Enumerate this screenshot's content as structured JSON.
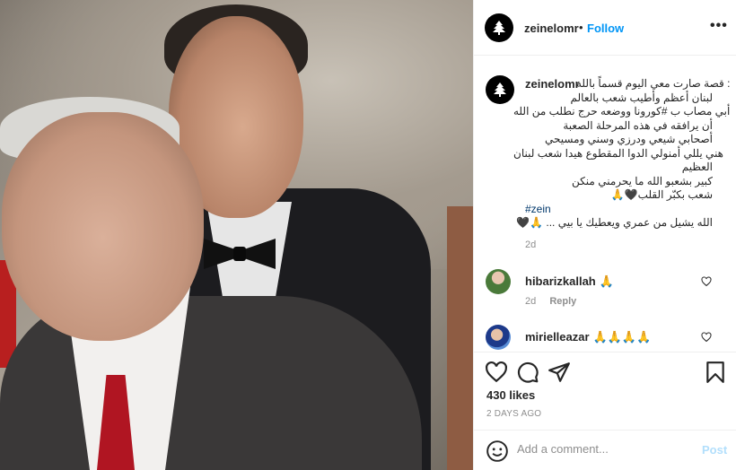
{
  "post": {
    "username": "zeinelomr",
    "dot": "•",
    "follow_label": "Follow",
    "more_label": "•••"
  },
  "caption": {
    "username": "zeinelomr",
    "lines": [
      "قصة صارت معي اليوم قسماً بالله :",
      "لبنان أعظم وأطيب شعب بالعالم",
      "أبي مصاب ب #كورونا ووضعه حرج نطلب من الله",
      "أن يرافقه في هذه المرحلة الصعبة",
      "أصحابي شيعي ودرزي وسني ومسيحي",
      "هني يللي أمنولي الدوا المقطوع هيدا شعب لبنان",
      "العظيم",
      "كبير بشعبو الله ما يحرمني منكن",
      "🙏🖤شعب بكبّر القلب",
      "#zein",
      "🖤🙏 ... الله يشيل من عمري ويعطيك يا بيي"
    ],
    "time": "2d"
  },
  "comments": [
    {
      "user": "hibarizkallah",
      "text": "🙏",
      "time": "2d",
      "reply_label": "Reply"
    },
    {
      "user": "mirielleazar",
      "text": "🙏🙏🙏🙏",
      "time": "",
      "reply_label": ""
    }
  ],
  "actions": {
    "likes": "430 likes",
    "posted_ago": "2 DAYS AGO",
    "comment_placeholder": "Add a comment...",
    "post_label": "Post"
  },
  "icons": [
    "cedar-logo-icon",
    "heart-icon",
    "comment-icon",
    "share-icon",
    "bookmark-icon",
    "emoji-icon",
    "more-icon"
  ],
  "colors": {
    "link": "#0095f6",
    "post_disabled": "#b2dffc",
    "meta": "#8e8e8e",
    "tie": "#b01522"
  }
}
